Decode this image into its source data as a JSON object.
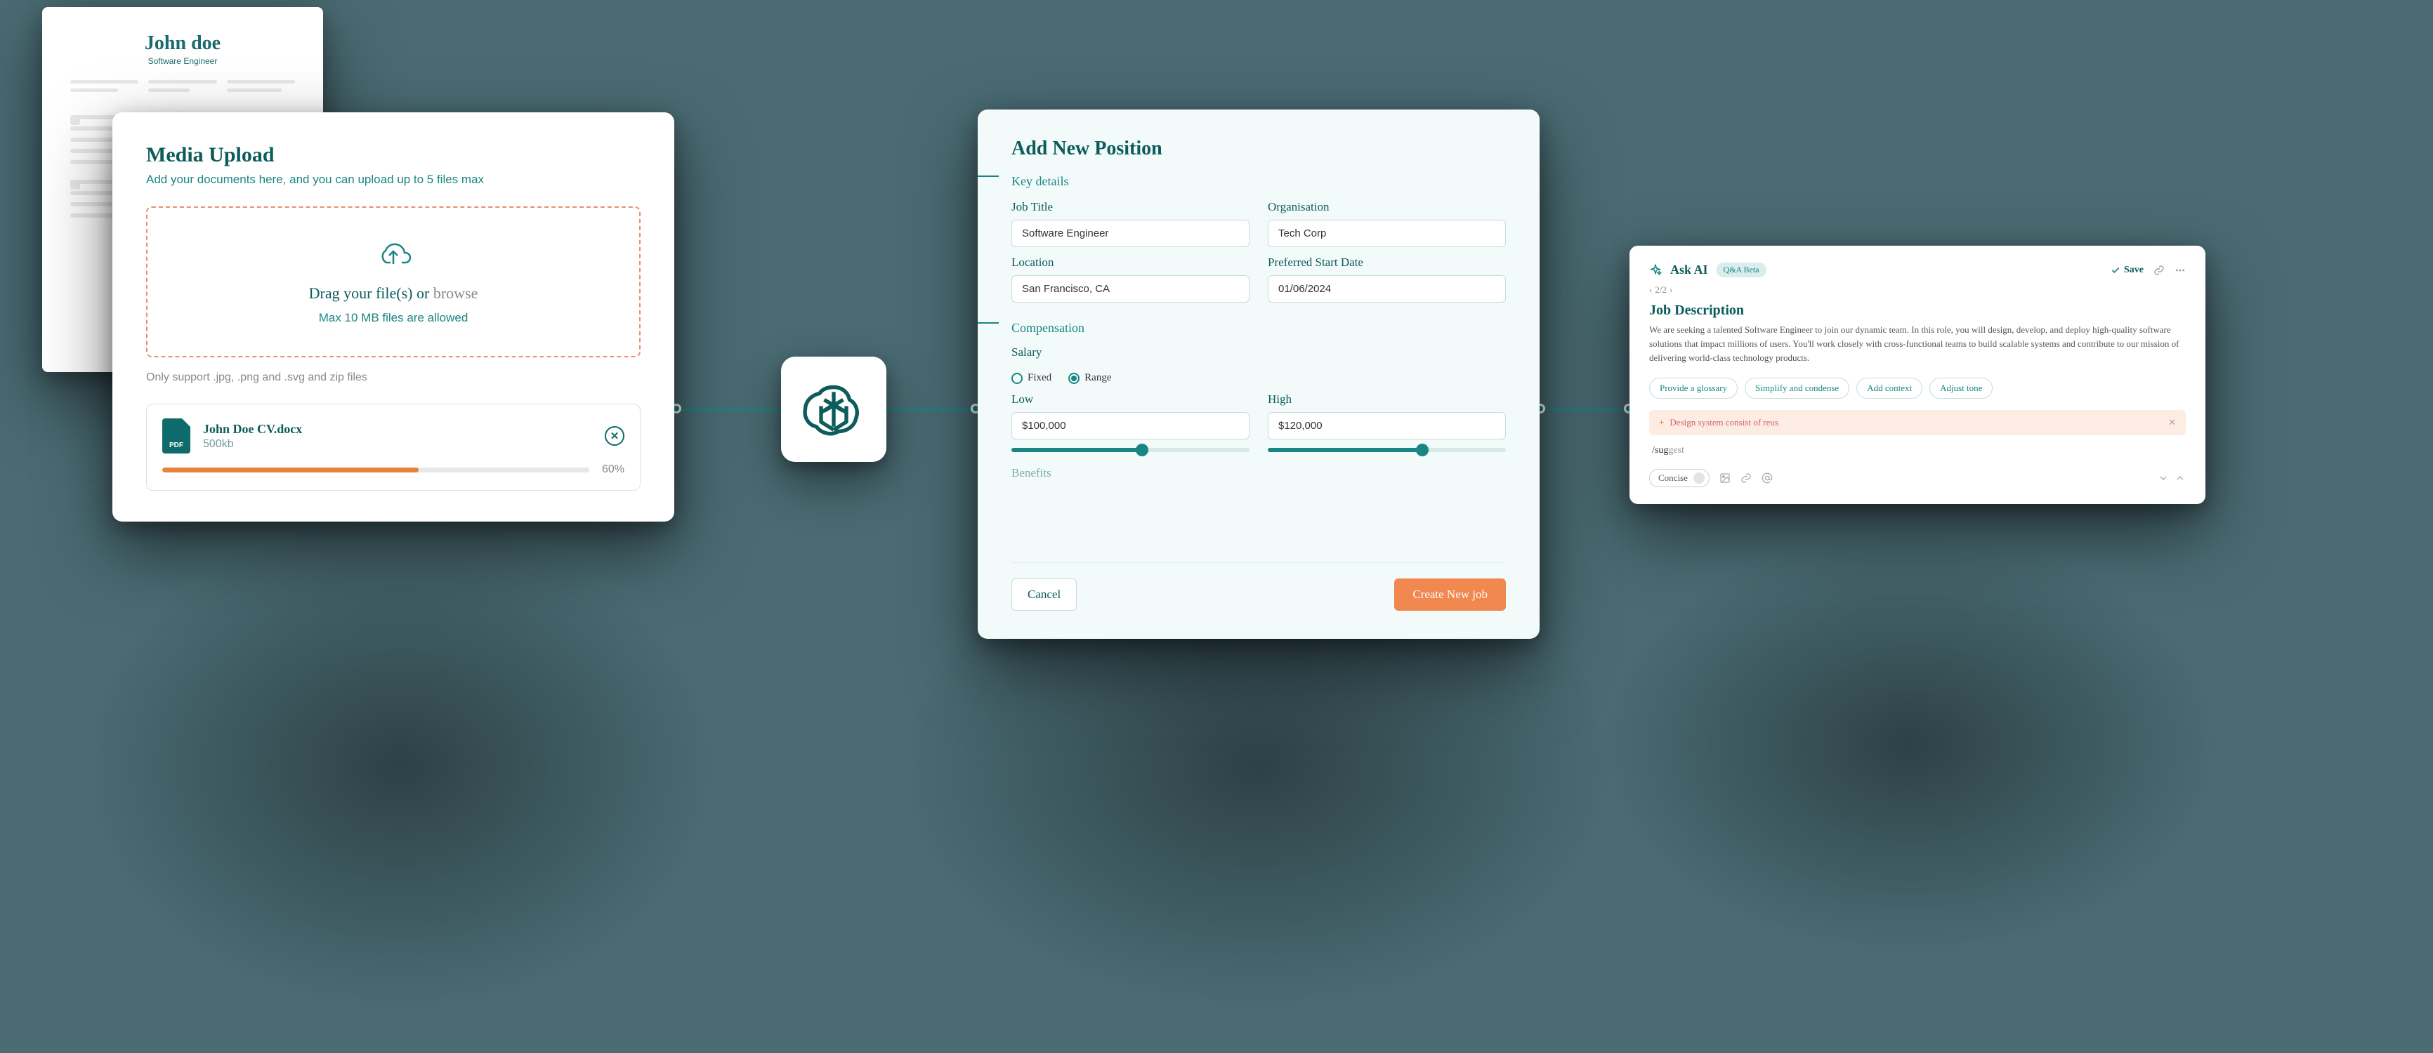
{
  "resume": {
    "name": "John doe",
    "title": "Software Engineer"
  },
  "upload": {
    "title": "Media Upload",
    "subtitle": "Add your documents here, and you can upload up to 5 files max",
    "drop_prefix": "Drag your file(s) or ",
    "drop_browse": "browse",
    "max_text": "Max 10 MB files are allowed",
    "support_text": "Only support .jpg, .png and .svg and zip files",
    "file": {
      "name": "John Doe CV.docx",
      "size": "500kb",
      "pct_label": "60%",
      "pct": 60,
      "badge": "PDF"
    }
  },
  "position": {
    "title": "Add New Position",
    "key_details": "Key details",
    "job_title_label": "Job Title",
    "job_title_value": "Software Engineer",
    "org_label": "Organisation",
    "org_value": "Tech Corp",
    "location_label": "Location",
    "location_value": "San Francisco, CA",
    "start_label": "Preferred Start Date",
    "start_value": "01/06/2024",
    "compensation": "Compensation",
    "salary_label": "Salary",
    "radio_fixed": "Fixed",
    "radio_range": "Range",
    "low_label": "Low",
    "low_value": "$100,000",
    "high_label": "High",
    "high_value": "$120,000",
    "benefits_truncated": "Benefits",
    "cancel": "Cancel",
    "create": "Create New job"
  },
  "ai": {
    "title": "Ask AI",
    "badge": "Q&A Beta",
    "save": "Save",
    "pager": "2/2",
    "jd_title": "Job Description",
    "jd_body": "We are seeking a talented Software Engineer to join our dynamic team. In this role, you will design, develop, and deploy high-quality software solutions that impact millions of users. You'll work closely with cross-functional teams to build scalable systems and contribute to our mission of delivering world-class technology products.",
    "chips": [
      "Provide a glossary",
      "Simplify and condense",
      "Add context",
      "Adjust tone"
    ],
    "alert": "Design system consist of reus",
    "suggest_typed": "/sug",
    "suggest_ghost": "gest",
    "concise": "Concise"
  }
}
